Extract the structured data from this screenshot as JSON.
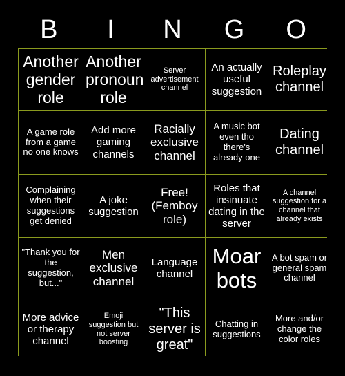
{
  "card": {
    "header_letters": [
      "B",
      "I",
      "N",
      "G",
      "O"
    ],
    "colors": {
      "background": "#000000",
      "grid_line": "#8a9a1e",
      "text": "#ffffff"
    },
    "cells": [
      {
        "text": "Another gender role",
        "size": "fs-xxl"
      },
      {
        "text": "Another pronoun role",
        "size": "fs-xxl"
      },
      {
        "text": "Server advertisement channel",
        "size": "fs-xs"
      },
      {
        "text": "An actually useful suggestion",
        "size": "fs-m"
      },
      {
        "text": "Roleplay channel",
        "size": "fs-xl"
      },
      {
        "text": "A game role from a game no one knows",
        "size": "fs-s"
      },
      {
        "text": "Add more gaming channels",
        "size": "fs-m"
      },
      {
        "text": "Racially exclusive channel",
        "size": "fs-l"
      },
      {
        "text": "A music bot even tho there's already one",
        "size": "fs-s"
      },
      {
        "text": "Dating channel",
        "size": "fs-xl"
      },
      {
        "text": "Complaining when their suggestions get denied",
        "size": "fs-s"
      },
      {
        "text": "A joke suggestion",
        "size": "fs-m"
      },
      {
        "text": "Free! (Femboy role)",
        "size": "fs-l"
      },
      {
        "text": "Roles that insinuate dating in the server",
        "size": "fs-m"
      },
      {
        "text": "A channel suggestion for a channel that already exists",
        "size": "fs-xs"
      },
      {
        "text": "\"Thank you for the suggestion, but...\"",
        "size": "fs-s"
      },
      {
        "text": "Men exclusive channel",
        "size": "fs-l"
      },
      {
        "text": "Language channel",
        "size": "fs-m"
      },
      {
        "text": "Moar bots",
        "size": "fs-huge"
      },
      {
        "text": "A bot spam or general spam channel",
        "size": "fs-s"
      },
      {
        "text": "More advice or therapy channel",
        "size": "fs-m"
      },
      {
        "text": "Emoji suggestion but not server boosting",
        "size": "fs-xs"
      },
      {
        "text": "\"This server is great\"",
        "size": "fs-xl"
      },
      {
        "text": "Chatting in suggestions",
        "size": "fs-s"
      },
      {
        "text": "More and/or change the color roles",
        "size": "fs-s"
      }
    ]
  }
}
